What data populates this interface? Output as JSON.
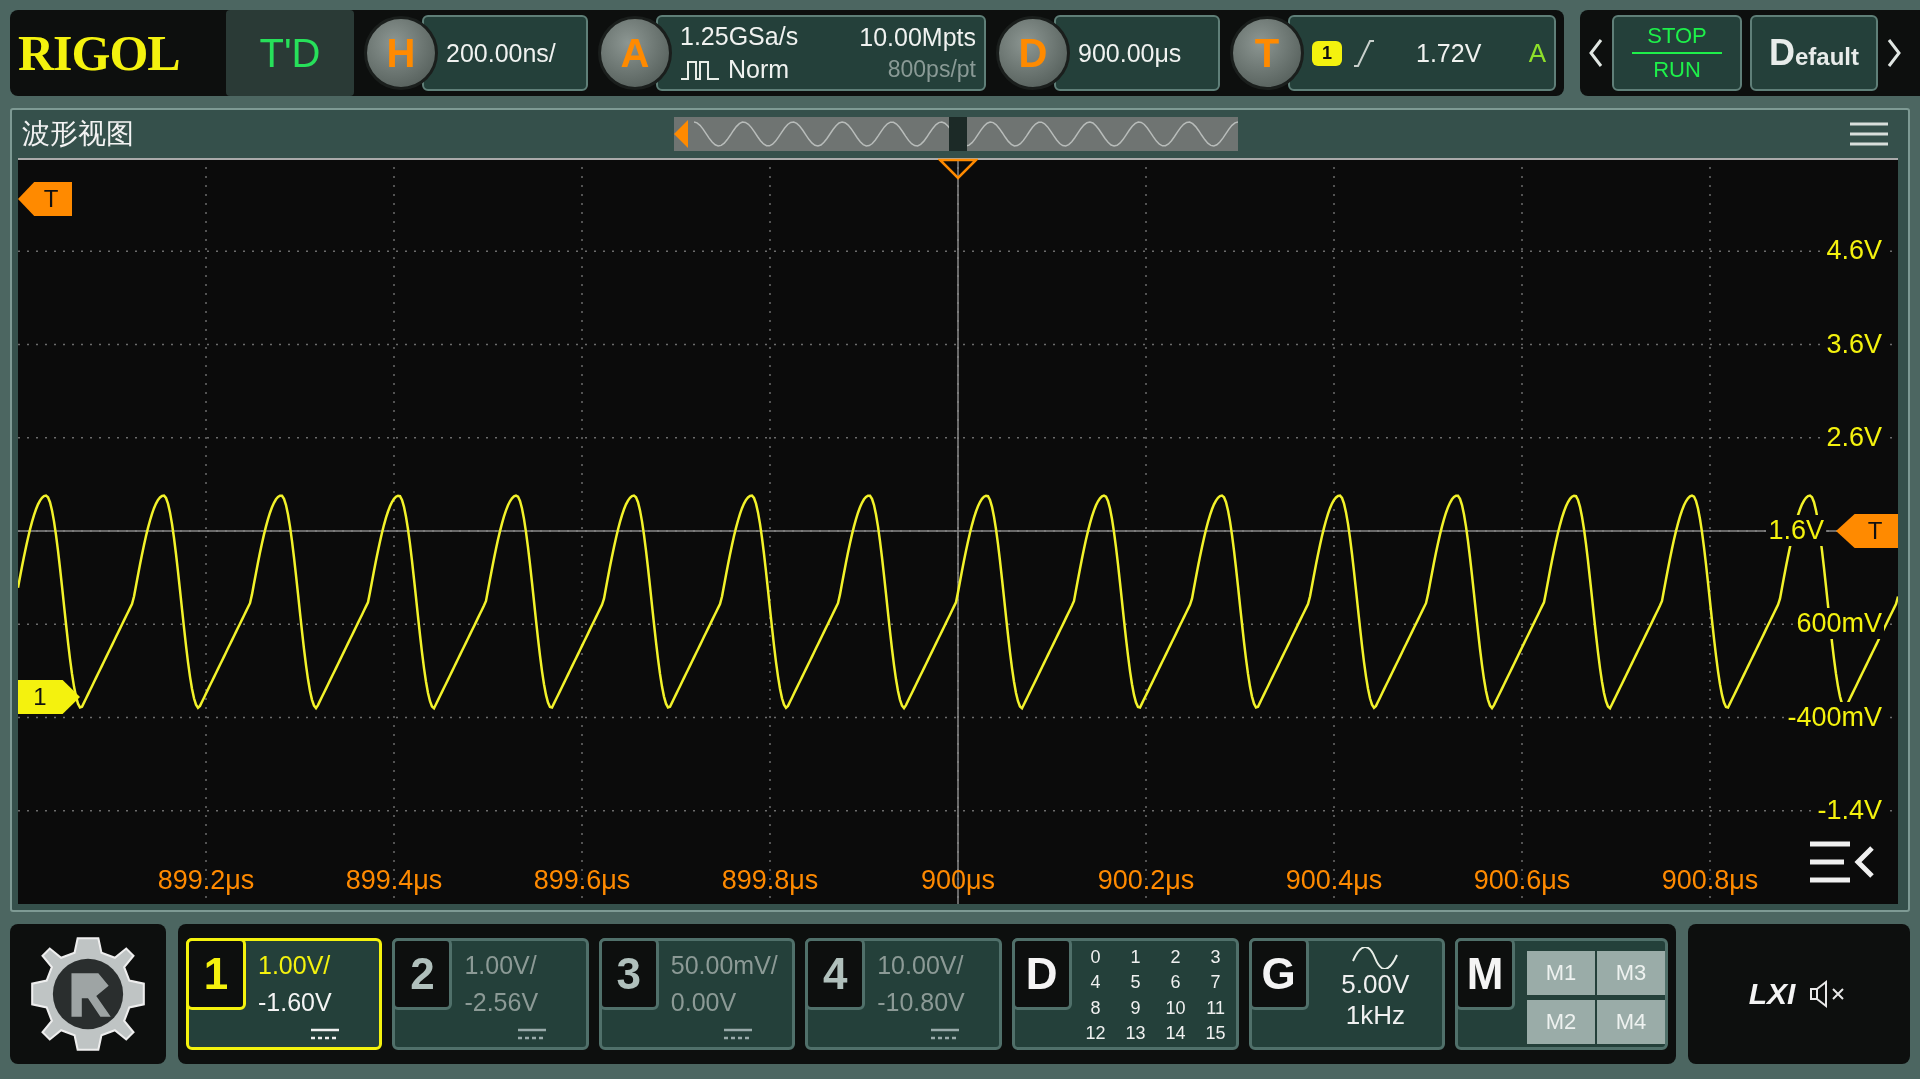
{
  "top_bar": {
    "brand": "RIGOL",
    "mode": "T'D",
    "horizontal": {
      "key": "H",
      "scale": "200.00ns/"
    },
    "acquisition": {
      "key": "A",
      "sample_rate": "1.25GSa/s",
      "memory_depth": "10.00Mpts",
      "mode": "Norm",
      "resolution": "800ps/pt"
    },
    "delay": {
      "key": "D",
      "value": "900.00μs"
    },
    "trigger": {
      "key": "T",
      "source": "1",
      "level": "1.72V",
      "sweep": "A"
    },
    "run_control": {
      "stop": "STOP",
      "run": "RUN"
    },
    "default_button": "Default"
  },
  "waveform_view": {
    "title": "波形视图",
    "y_labels": [
      "4.6V",
      "3.6V",
      "2.6V",
      "1.6V",
      "600mV",
      "-400mV",
      "-1.4V"
    ],
    "x_labels": [
      "899.2μs",
      "899.4μs",
      "899.6μs",
      "899.8μs",
      "900μs",
      "900.2μs",
      "900.4μs",
      "900.6μs",
      "900.8μs"
    ],
    "trigger_position_marker": "T",
    "trigger_level_marker": "T",
    "channel_marker": "1"
  },
  "channels": [
    {
      "number": "1",
      "scale": "1.00V/",
      "offset": "-1.60V",
      "selected": true
    },
    {
      "number": "2",
      "scale": "1.00V/",
      "offset": "-2.56V",
      "selected": false
    },
    {
      "number": "3",
      "scale": "50.00mV/",
      "offset": "0.00V",
      "selected": false
    },
    {
      "number": "4",
      "scale": "10.00V/",
      "offset": "-10.80V",
      "selected": false
    }
  ],
  "digital": {
    "key": "D",
    "bits": [
      "0",
      "1",
      "2",
      "3",
      "4",
      "5",
      "6",
      "7",
      "8",
      "9",
      "10",
      "11",
      "12",
      "13",
      "14",
      "15"
    ]
  },
  "generator": {
    "key": "G",
    "amplitude": "5.00V",
    "frequency": "1kHz"
  },
  "math": {
    "key": "M",
    "slots": [
      "M1",
      "M3",
      "M2",
      "M4"
    ]
  },
  "status": {
    "lxi": "LXI"
  }
}
